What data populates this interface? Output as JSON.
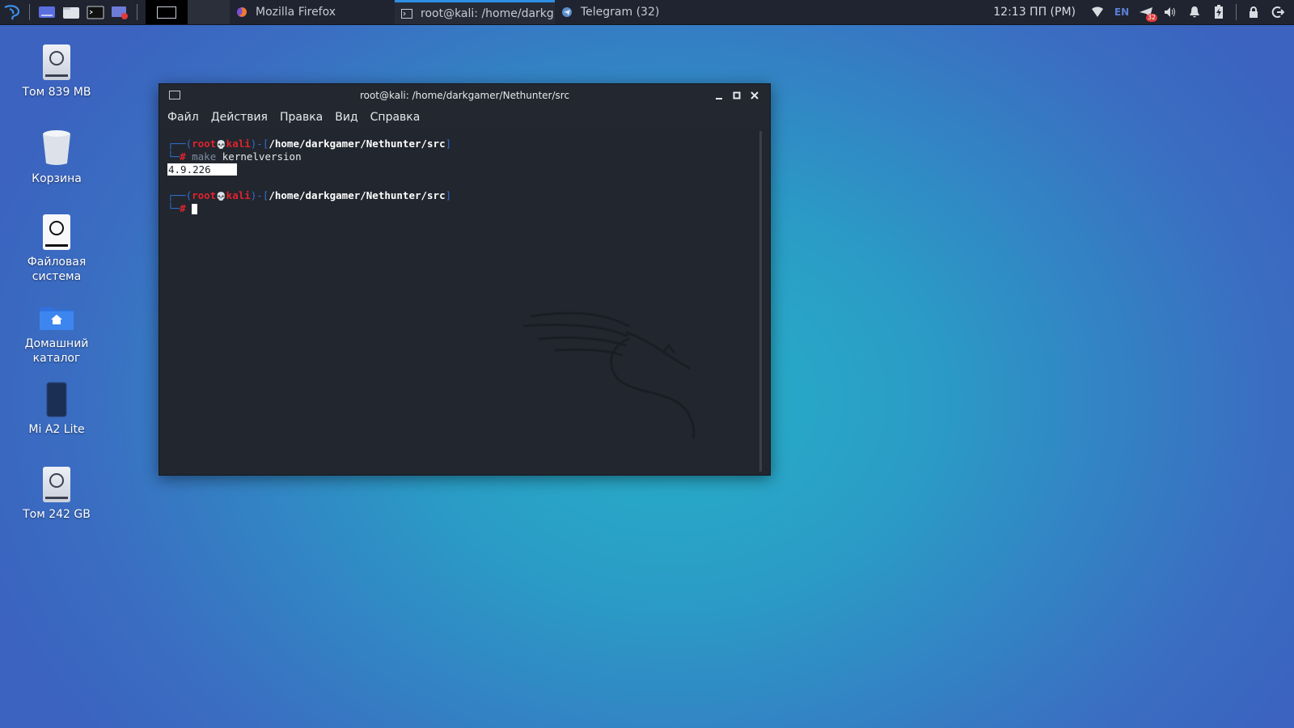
{
  "panel": {
    "tasks": [
      {
        "label": "Mozilla Firefox",
        "icon": "firefox-icon",
        "active": false
      },
      {
        "label": "root@kali: /home/darkg...",
        "icon": "terminal-icon",
        "active": true
      },
      {
        "label": "Telegram (32)",
        "icon": "telegram-icon",
        "active": false
      }
    ],
    "clock": "12:13 ПП (PM)",
    "language": "EN",
    "telegram_badge": "32"
  },
  "desktop": {
    "icons": [
      {
        "label": "Том 839 MB",
        "icon": "drive-icon"
      },
      {
        "label": "Корзина",
        "icon": "trash-icon"
      },
      {
        "label": "Файловая система",
        "icon": "filesystem-icon"
      },
      {
        "label": "Домашний каталог",
        "icon": "home-folder-icon"
      },
      {
        "label": "Mi A2 Lite",
        "icon": "phone-icon"
      },
      {
        "label": "Том 242 GB",
        "icon": "drive-icon"
      }
    ]
  },
  "terminal": {
    "title": "root@kali: /home/darkgamer/Nethunter/src",
    "menu": [
      "Файл",
      "Действия",
      "Правка",
      "Вид",
      "Справка"
    ],
    "prompt_user": "root",
    "prompt_skull": "💀",
    "prompt_host": "kali",
    "prompt_path": "/home/darkgamer/Nethunter/src",
    "prompt_symbol": "#",
    "command": "make",
    "command_arg": "kernelversion",
    "output": "4.9.226"
  }
}
